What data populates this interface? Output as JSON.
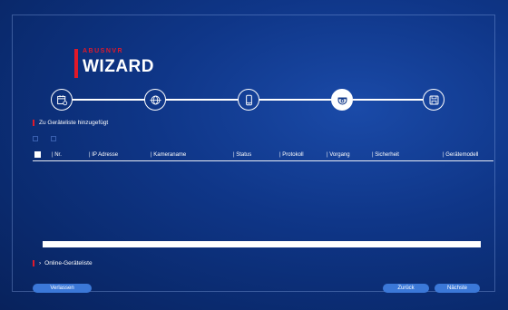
{
  "brand": {
    "sub": "ABUSNVR",
    "title": "WIZARD"
  },
  "steps": [
    {
      "icon": "calendar-settings-icon",
      "active": false
    },
    {
      "icon": "network-globe-icon",
      "active": false
    },
    {
      "icon": "mobile-phone-icon",
      "active": false
    },
    {
      "icon": "camera-dome-icon",
      "active": true
    },
    {
      "icon": "save-disk-icon",
      "active": false
    }
  ],
  "added_section": {
    "label": "Zu Geräteliste hinzugefügt"
  },
  "table": {
    "columns": [
      "| Nr.",
      "| IP Adresse",
      "| Kameraname",
      "| Status",
      "| Protokoll",
      "| Vorgang",
      "| Sicherheit",
      "| Gerätemodell"
    ],
    "rows": []
  },
  "online_section": {
    "chevron": "›",
    "label": "Online-Geräteliste"
  },
  "buttons": {
    "exit": "Verlassen",
    "back": "Zurück",
    "next": "Nächste"
  },
  "colors": {
    "accent_red": "#e0192a",
    "button_blue": "#3b78d8",
    "background": "#0f3688"
  }
}
